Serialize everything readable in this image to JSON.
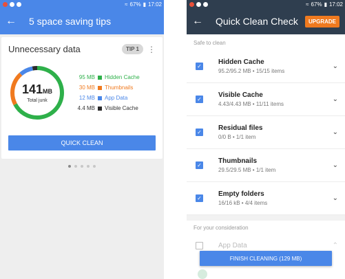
{
  "status_bar": {
    "right": "☀︎ 67% ▮ 17:02",
    "signal": "67%",
    "time": "17:02"
  },
  "left": {
    "appbar": {
      "title": "5 space saving tips"
    },
    "card": {
      "title": "Unnecessary data",
      "tip_badge": "TIP 1",
      "donut": {
        "value": "141",
        "unit": "MB",
        "label": "Total junk"
      },
      "legend": [
        {
          "size": "95 MB",
          "name": "Hidden Cache",
          "color": "#2eb04a",
          "value_mb": 95
        },
        {
          "size": "30 MB",
          "name": "Thumbnails",
          "color": "#f07a1f",
          "value_mb": 30
        },
        {
          "size": "12 MB",
          "name": "App Data",
          "color": "#4a87e8",
          "value_mb": 12
        },
        {
          "size": "4.4 MB",
          "name": "Visible Cache",
          "color": "#2b2b2b",
          "value_mb": 4.4
        }
      ],
      "button": "QUICK CLEAN"
    }
  },
  "right": {
    "appbar": {
      "title": "Quick Clean Check",
      "upgrade": "UPGRADE"
    },
    "safe_label": "Safe to clean",
    "items": [
      {
        "title": "Hidden Cache",
        "sub": "95.2/95.2 MB • 15/15 items"
      },
      {
        "title": "Visible Cache",
        "sub": "4.43/4.43 MB • 11/11 items"
      },
      {
        "title": "Residual files",
        "sub": "0/0 B • 1/1 item"
      },
      {
        "title": "Thumbnails",
        "sub": "29.5/29.5 MB • 1/1 item"
      },
      {
        "title": "Empty folders",
        "sub": "16/16 kB • 4/4 items"
      }
    ],
    "consider_label": "For your consideration",
    "consider_items": [
      {
        "title": "App Data"
      }
    ],
    "finish_button": "FINISH CLEANING (129 MB)"
  }
}
